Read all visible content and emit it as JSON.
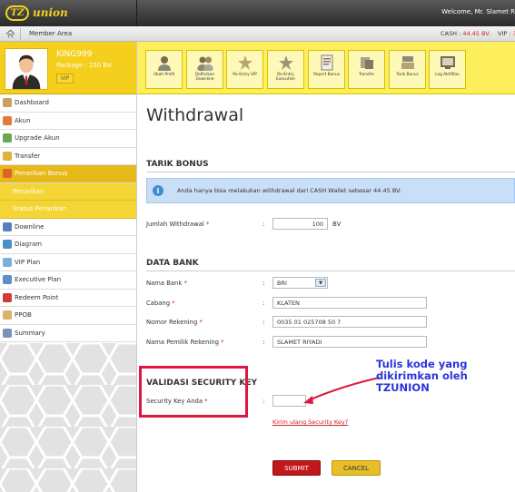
{
  "app": {
    "logo_badge": "TZ",
    "logo_text": "union",
    "welcome": "Welcome, Mr. Slamet R"
  },
  "subbar": {
    "member_area": "Member Area",
    "cash_label": "CASH : ",
    "cash_value": "44.45 BV.",
    "vip_label": "VIP : ",
    "vip_value": "3"
  },
  "profile": {
    "username": "KING999",
    "package": "Package : 150 BV.",
    "badge": "VIP"
  },
  "toolbar": [
    {
      "label": "Ubah Profil",
      "icon": "profile-icon"
    },
    {
      "label": "Daftarkan Downline",
      "icon": "register-downline-icon"
    },
    {
      "label": "Re-Entry VIP",
      "icon": "reentry-vip-icon"
    },
    {
      "label": "Re-Entry Executive",
      "icon": "reentry-executive-icon"
    },
    {
      "label": "Report Bonus",
      "icon": "report-icon"
    },
    {
      "label": "Transfer",
      "icon": "transfer-icon"
    },
    {
      "label": "Tarik Bonus",
      "icon": "withdraw-icon"
    },
    {
      "label": "Log Aktifitas",
      "icon": "log-icon"
    }
  ],
  "sidebar": {
    "items": [
      {
        "label": "Dashboard",
        "icon": "home-icon"
      },
      {
        "label": "Akun",
        "icon": "account-icon"
      },
      {
        "label": "Upgrade Akun",
        "icon": "upgrade-icon"
      },
      {
        "label": "Transfer",
        "icon": "transfer-icon"
      },
      {
        "label": "Penarikan Bonus",
        "icon": "bonus-icon"
      },
      {
        "label": "Downline",
        "icon": "downline-icon"
      },
      {
        "label": "Diagram",
        "icon": "diagram-icon"
      },
      {
        "label": "VIP Plan",
        "icon": "vip-plan-icon"
      },
      {
        "label": "Executive Plan",
        "icon": "executive-plan-icon"
      },
      {
        "label": "Redeem Point",
        "icon": "redeem-icon"
      },
      {
        "label": "PPOB",
        "icon": "ppob-icon"
      },
      {
        "label": "Summary",
        "icon": "summary-icon"
      }
    ],
    "sub_items": [
      "Penarikan",
      "Status Penarikan"
    ]
  },
  "main": {
    "title": "Withdrawal",
    "section_tarik": "TARIK BONUS",
    "alert": "Anda hanya bisa melakukan withdrawal dari CASH Wallet sebesar 44.45 BV.",
    "jumlah_label": "Jumlah Withdrawal ",
    "jumlah_value": "100",
    "jumlah_unit": "BV",
    "section_bank": "DATA BANK",
    "bank_fields": [
      {
        "label": "Nama Bank ",
        "value": "BRI"
      },
      {
        "label": "Cabang ",
        "value": "KLATEN"
      },
      {
        "label": "Nomor Rekening ",
        "value": "0035 01 025708 50 7"
      },
      {
        "label": "Nama Pemilik Rekening ",
        "value": "SLAMET RIYADI"
      }
    ],
    "section_security": "VALIDASI SECURITY KEY",
    "security_label": "Security Key Anda ",
    "security_value": "",
    "resend_link": "Kirim ulang Security Key?",
    "required_mark": "*",
    "colon": ":",
    "submit": "SUBMIT",
    "cancel": "CANCEL"
  },
  "annotation": {
    "text": "Tulis kode yang dikirimkan oleh TZUNION",
    "color": "#2a35d9"
  },
  "colors": {
    "accent_yellow": "#f5cf1e",
    "submit_red": "#c2181b",
    "highlight_red": "#e0163f"
  }
}
